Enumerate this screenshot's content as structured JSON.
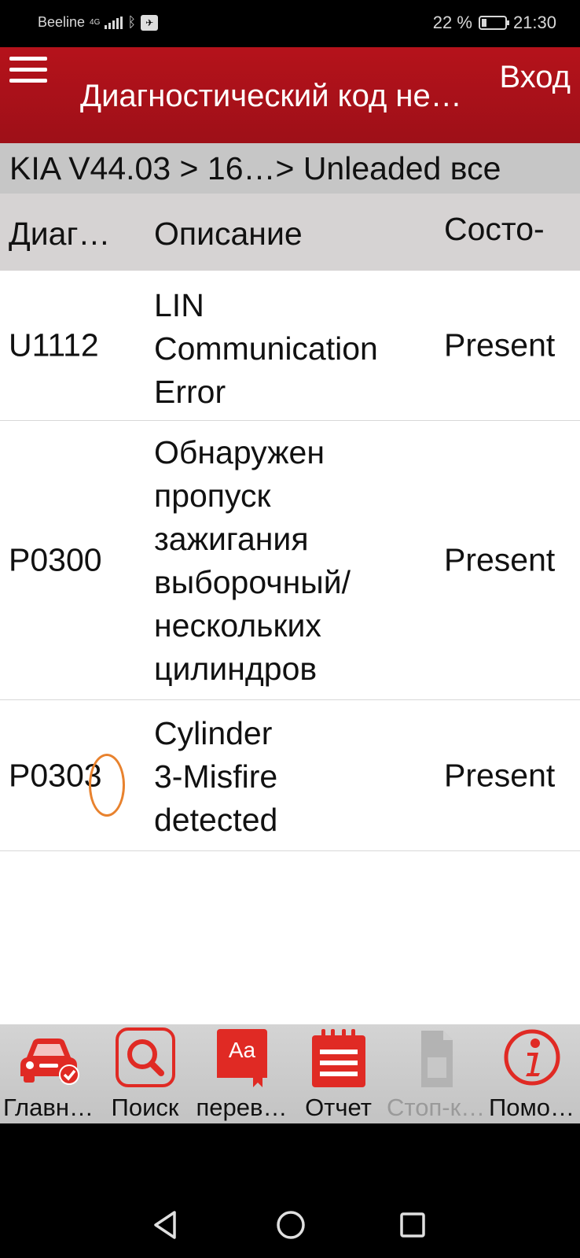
{
  "status_bar": {
    "carrier": "Beeline",
    "network": "4G",
    "battery": "22 %",
    "battery_fraction": 0.22,
    "time": "21:30"
  },
  "header": {
    "title": "Диагностический код не…",
    "login_label": "Вход"
  },
  "breadcrumb": "KIA V44.03 > 16…> Unleaded все",
  "table": {
    "columns": [
      "Диаг…",
      "Описание",
      "Состо-"
    ],
    "rows": [
      {
        "code": "U1112",
        "description": [
          "LIN",
          "Communication",
          "Error"
        ],
        "status": "Present"
      },
      {
        "code": "P0300",
        "description": [
          "Обнаружен",
          "пропуск",
          "зажигания",
          "выборочный/",
          "нескольких",
          "цилиндров"
        ],
        "status": "Present"
      },
      {
        "code": "P0303",
        "description": [
          "Cylinder",
          "3-Misfire",
          "detected"
        ],
        "status": "Present"
      }
    ]
  },
  "toolbar": {
    "items": [
      {
        "label": "Главн…",
        "icon": "car-check-icon",
        "enabled": true
      },
      {
        "label": "Поиск",
        "icon": "search-icon",
        "enabled": true
      },
      {
        "label": "перев…",
        "icon": "translate-book-icon",
        "enabled": true
      },
      {
        "label": "Отчет",
        "icon": "report-icon",
        "enabled": true
      },
      {
        "label": "Стоп-к…",
        "icon": "freeze-frame-icon",
        "enabled": false
      },
      {
        "label": "Помо…",
        "icon": "info-icon",
        "enabled": true
      }
    ]
  },
  "colors": {
    "header_red": "#b5121b",
    "icon_red": "#e02a24",
    "annotation_orange": "#e8822e"
  }
}
